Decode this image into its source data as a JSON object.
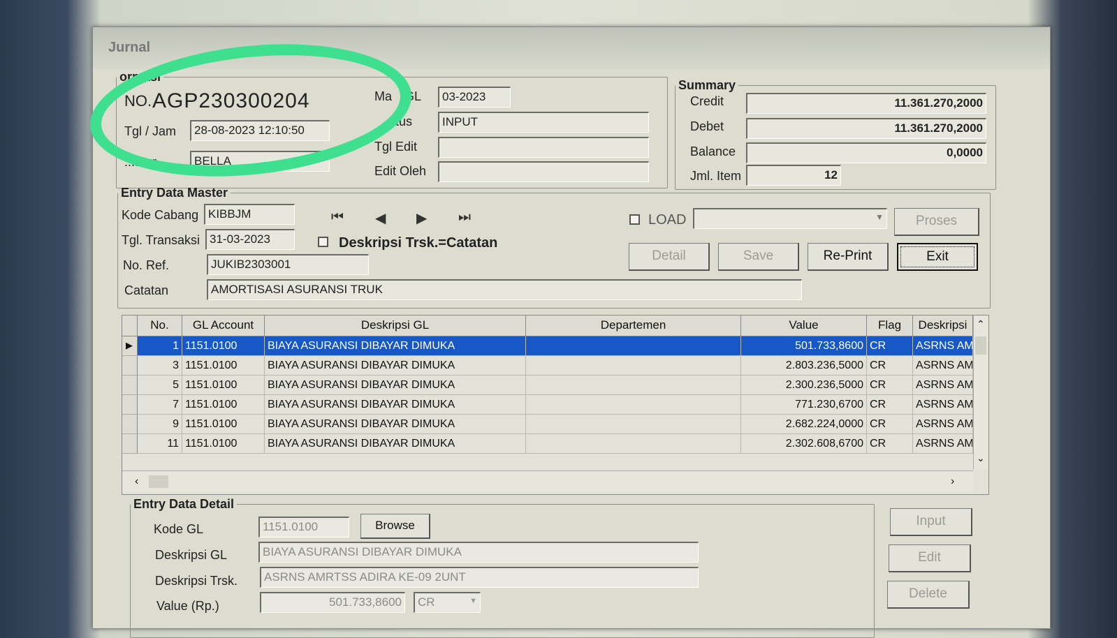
{
  "window": {
    "title": "Jurnal"
  },
  "info": {
    "legend": "ormasi",
    "no_label": "NO.",
    "no_value": "AGP230300204",
    "tgl_label": "Tgl / Jam",
    "tgl_value": "28-08-2023 12:10:50",
    "operator_label": "...ator",
    "operator_value": "BELLA",
    "mas_label": "Ma",
    "mas_label2": "GL",
    "mas_value": "03-2023",
    "status_label": "atus",
    "status_value": "INPUT",
    "tgledit_label": "Tgl Edit",
    "tgledit_value": "",
    "editoleh_label": "Edit Oleh",
    "editoleh_value": ""
  },
  "summary": {
    "legend": "Summary",
    "credit_label": "Credit",
    "credit_value": "11.361.270,2000",
    "debet_label": "Debet",
    "debet_value": "11.361.270,2000",
    "balance_label": "Balance",
    "balance_value": "0,0000",
    "jml_label": "Jml. Item",
    "jml_value": "12"
  },
  "master": {
    "legend": "Entry Data Master",
    "kode_label": "Kode Cabang",
    "kode_value": "KIBBJM",
    "tgl_label": "Tgl. Transaksi",
    "tgl_value": "31-03-2023",
    "desk_check_label": "Deskripsi Trsk.=Catatan",
    "noref_label": "No. Ref.",
    "noref_value": "JUKIB2303001",
    "catatan_label": "Catatan",
    "catatan_value": "AMORTISASI ASURANSI TRUK",
    "load_label": "LOAD",
    "proses_label": "Proses",
    "detail_label": "Detail",
    "save_label": "Save",
    "reprint_label": "Re-Print",
    "exit_label": "Exit",
    "nav": {
      "first": "⏮",
      "prev": "◀",
      "next": "▶",
      "last": "⏭"
    }
  },
  "grid": {
    "headers": [
      "No.",
      "GL Account",
      "Deskripsi GL",
      "Departemen",
      "Value",
      "Flag",
      "Deskripsi"
    ],
    "rows": [
      {
        "no": "1",
        "gl": "1151.0100",
        "desk": "BIAYA ASURANSI DIBAYAR DIMUKA",
        "dept": "",
        "value": "501.733,8600",
        "flag": "CR",
        "deskripsi": "ASRNS AM"
      },
      {
        "no": "3",
        "gl": "1151.0100",
        "desk": "BIAYA ASURANSI DIBAYAR DIMUKA",
        "dept": "",
        "value": "2.803.236,5000",
        "flag": "CR",
        "deskripsi": "ASRNS AM"
      },
      {
        "no": "5",
        "gl": "1151.0100",
        "desk": "BIAYA ASURANSI DIBAYAR DIMUKA",
        "dept": "",
        "value": "2.300.236,5000",
        "flag": "CR",
        "deskripsi": "ASRNS AM"
      },
      {
        "no": "7",
        "gl": "1151.0100",
        "desk": "BIAYA ASURANSI DIBAYAR DIMUKA",
        "dept": "",
        "value": "771.230,6700",
        "flag": "CR",
        "deskripsi": "ASRNS AM"
      },
      {
        "no": "9",
        "gl": "1151.0100",
        "desk": "BIAYA ASURANSI DIBAYAR DIMUKA",
        "dept": "",
        "value": "2.682.224,0000",
        "flag": "CR",
        "deskripsi": "ASRNS AM"
      },
      {
        "no": "11",
        "gl": "1151.0100",
        "desk": "BIAYA ASURANSI DIBAYAR DIMUKA",
        "dept": "",
        "value": "2.302.608,6700",
        "flag": "CR",
        "deskripsi": "ASRNS AM"
      }
    ]
  },
  "detail": {
    "legend": "Entry Data Detail",
    "kodegl_label": "Kode GL",
    "kodegl_value": "1151.0100",
    "browse_label": "Browse",
    "deskgl_label": "Deskripsi GL",
    "deskgl_value": "BIAYA ASURANSI DIBAYAR DIMUKA",
    "desktrsk_label": "Deskripsi Trsk.",
    "desktrsk_value": "ASRNS AMRTSS ADIRA KE-09 2UNT",
    "value_label": "Value (Rp.)",
    "value_value": "501.733,8600",
    "flag_value": "CR",
    "input_label": "Input",
    "edit_label": "Edit",
    "delete_label": "Delete"
  },
  "colors": {
    "selection": "#1758c6",
    "annotation": "#3ee08f"
  }
}
